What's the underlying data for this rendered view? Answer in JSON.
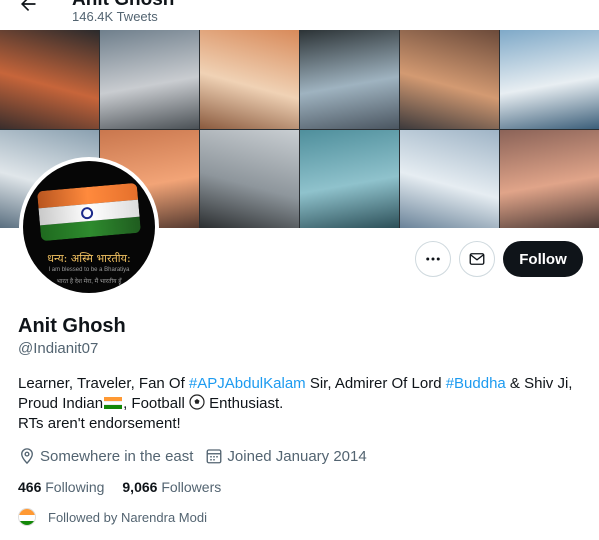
{
  "header": {
    "title": "Anit Ghosh",
    "tweet_count": "146.4K Tweets"
  },
  "banner": {
    "tiles": [
      {
        "c1": "#2a2a2c",
        "c2": "#c7653a",
        "c3": "#3a2e2c"
      },
      {
        "c1": "#6f7f8c",
        "c2": "#c9ccd0",
        "c3": "#4a5055"
      },
      {
        "c1": "#d88a5a",
        "c2": "#f0d2b5",
        "c3": "#8a5a3e"
      },
      {
        "c1": "#2c3336",
        "c2": "#9fb3c0",
        "c3": "#4a5560"
      },
      {
        "c1": "#6b4a3a",
        "c2": "#d39a72",
        "c3": "#3d3a3c"
      },
      {
        "c1": "#7fa9c8",
        "c2": "#e8eef2",
        "c3": "#3b5e79"
      },
      {
        "c1": "#8aa0b0",
        "c2": "#e0e6ea",
        "c3": "#5a6f80"
      },
      {
        "c1": "#c9774e",
        "c2": "#f2a477",
        "c3": "#553a30"
      },
      {
        "c1": "#c9ced2",
        "c2": "#8e969c",
        "c3": "#2c2f31"
      },
      {
        "c1": "#4f8f9c",
        "c2": "#8fc2cc",
        "c3": "#2c4f58"
      },
      {
        "c1": "#9fb4c6",
        "c2": "#e6edf2",
        "c3": "#6a8399"
      },
      {
        "c1": "#8b6358",
        "c2": "#e0a489",
        "c3": "#4c3a36"
      }
    ]
  },
  "avatar": {
    "line1": "धन्य: अस्मि भारतीय:",
    "line2": "I am blessed to be a Bharatiya",
    "line3": "भारत है देश मेरा, मैं भारतीय हूँ"
  },
  "actions": {
    "follow_label": "Follow"
  },
  "profile": {
    "name": "Anit Ghosh",
    "handle": "@Indianit07",
    "bio": {
      "t1": "Learner, Traveler, Fan Of ",
      "tag1": "#APJAbdulKalam",
      "t2": " Sir, Admirer Of Lord ",
      "tag2": "#Buddha",
      "t3": " & Shiv Ji,",
      "t4": "Proud Indian",
      "t5": ", Football ",
      "t6": " Enthusiast.",
      "t7": "RTs aren't endorsement!"
    },
    "location": "Somewhere in the east",
    "joined": "Joined January 2014",
    "following_count": "466",
    "following_label": "Following",
    "followers_count": "9,066",
    "followers_label": "Followers",
    "followed_by": "Followed by Narendra Modi"
  },
  "colors": {
    "accent": "#1d9bf0",
    "text": "#0f1419",
    "muted": "#536471",
    "follow_bg": "#0f1419"
  }
}
